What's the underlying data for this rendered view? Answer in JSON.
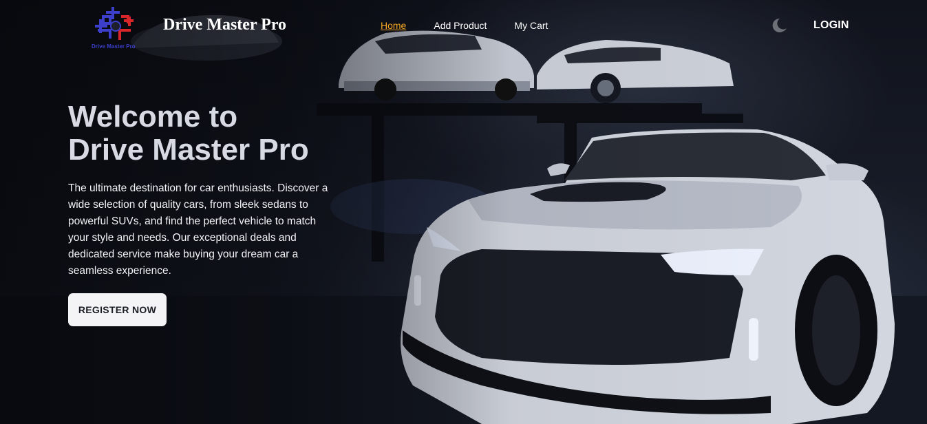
{
  "nav": {
    "logo_caption": "Drive Master Pro",
    "brand": "Drive Master Pro",
    "links": [
      {
        "label": "Home",
        "active": true
      },
      {
        "label": "Add Product",
        "active": false
      },
      {
        "label": "My Cart",
        "active": false
      }
    ],
    "theme_icon": "moon-icon",
    "login_label": "LOGIN"
  },
  "hero": {
    "title_line1": "Welcome to",
    "title_line2": "Drive Master Pro",
    "description": "The ultimate destination for car enthusiasts. Discover a wide selection of quality cars, from sleek sedans to powerful SUVs, and find the perfect vehicle to match your style and needs. Our exceptional deals and dedicated service make buying your dream car a seamless experience.",
    "cta_label": "REGISTER NOW",
    "background_image": "white sports car in dark garage"
  },
  "colors": {
    "active_link": "#f5a623",
    "logo_blue": "#3b3fc9",
    "logo_red": "#d9262a",
    "title_text": "#d7dae3",
    "cta_background": "#f4f4f6"
  }
}
